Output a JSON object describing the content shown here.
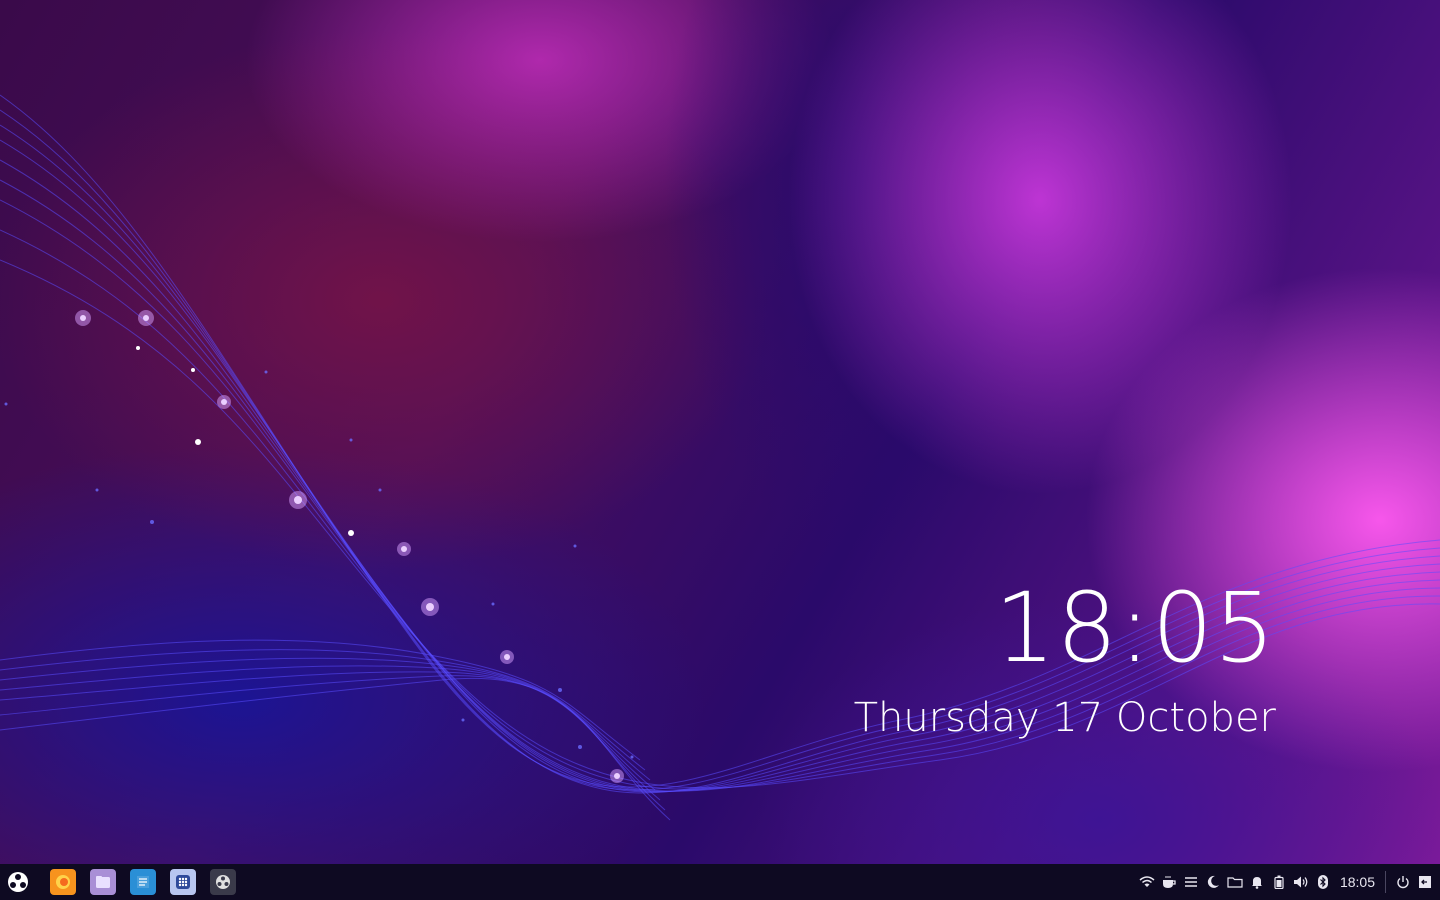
{
  "desktop": {
    "clock": {
      "time": "18:05",
      "date": "Thursday 17 October"
    }
  },
  "taskbar": {
    "start_icon": "start-menu-icon",
    "apps": [
      {
        "name": "firefox-icon",
        "color": "#f7931e"
      },
      {
        "name": "files-icon",
        "color": "#a98fd6"
      },
      {
        "name": "text-editor-icon",
        "color": "#2a8fd6"
      },
      {
        "name": "app-grid-icon",
        "color": "#b8c6f0"
      },
      {
        "name": "settings-icon",
        "color": "#d8d8d8"
      }
    ],
    "tray": {
      "icons": [
        "wifi-icon",
        "coffee-icon",
        "menu-icon",
        "night-mode-icon",
        "folder-icon",
        "notification-bell-icon",
        "battery-icon",
        "volume-icon",
        "bluetooth-icon"
      ],
      "time": "18:05",
      "power_icon": "power-icon",
      "show_desktop_icon": "show-desktop-icon"
    }
  }
}
